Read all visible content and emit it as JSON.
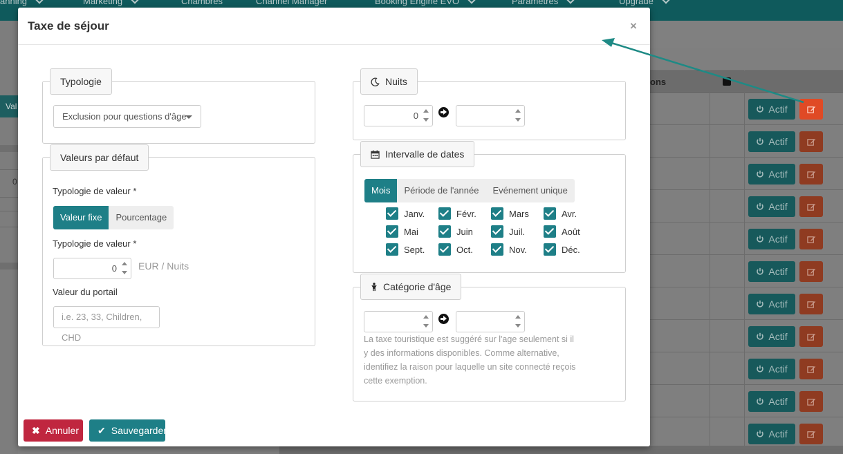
{
  "topnav": {
    "items": [
      "anning",
      "Marketing",
      "Chambres",
      "Channel Manager",
      "Booking Engine EVO",
      "Paramètres",
      "Upgrade"
    ]
  },
  "background": {
    "left_tab_label": "Val",
    "left_value": "0",
    "table_header_label": "ons",
    "status_label": "Actif",
    "row_count": 11
  },
  "modal": {
    "title": "Taxe de séjour",
    "close_symbol": "×",
    "typologie": {
      "legend": "Typologie",
      "selected": "Exclusion pour questions d'âge"
    },
    "valeurs": {
      "legend": "Valeurs par défaut",
      "typologie_label_1": "Typologie de valeur  *",
      "toggle": [
        "Valeur fixe",
        "Pourcentage"
      ],
      "active_toggle": "Valeur fixe",
      "typologie_label_2": "Typologie de valeur *",
      "amount": "0",
      "unit": "EUR / Nuits",
      "portal_label": "Valeur du portail",
      "portal_placeholder": "i.e. 23, 33, Children, CHD"
    },
    "nuits": {
      "legend": "Nuits",
      "from": "0",
      "to": ""
    },
    "dates": {
      "legend": "Intervalle de dates",
      "tabs": [
        "Mois",
        "Période de l'année",
        "Evénement unique"
      ],
      "active_tab": "Mois",
      "months": [
        "Janv.",
        "Févr.",
        "Mars",
        "Avr.",
        "Mai",
        "Juin",
        "Juil.",
        "Août",
        "Sept.",
        "Oct.",
        "Nov.",
        "Déc."
      ],
      "checked": [
        true,
        true,
        true,
        true,
        true,
        true,
        true,
        true,
        true,
        true,
        true,
        true
      ]
    },
    "age": {
      "legend": "Catégorie d'âge",
      "from": "",
      "to": "",
      "help_lines": [
        "La taxe touristique est suggéré sur l'age seulement si il",
        "y des informations disponibles. Comme alternative,",
        "identifiez la raison pour laquelle un site connecté reçois",
        "cette exemption."
      ]
    },
    "footer": {
      "cancel": "Annuler",
      "save": "Sauvegarder"
    }
  },
  "colors": {
    "accent": "#1e7f87",
    "danger": "#c0263f",
    "edit": "#e04a25",
    "annotation_arrow": "#1e8a85"
  }
}
